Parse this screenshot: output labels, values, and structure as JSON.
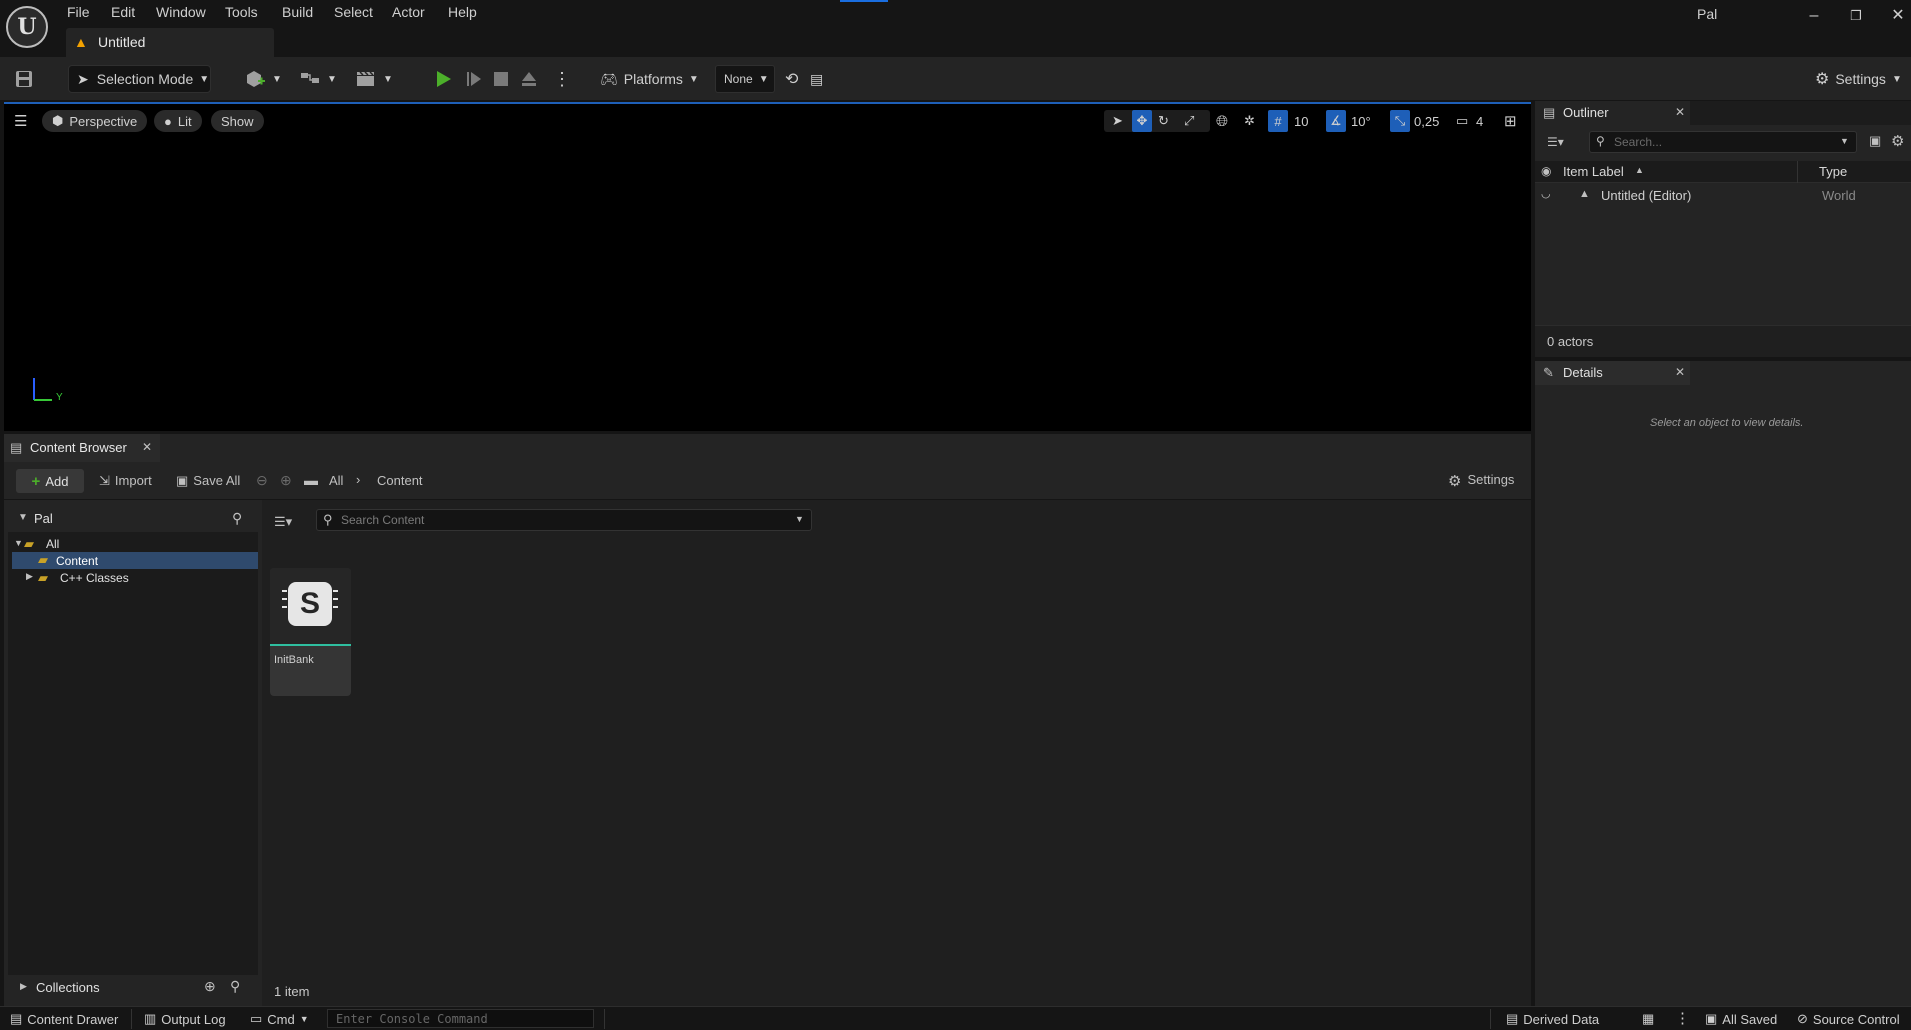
{
  "titlebar": {
    "menus": [
      "File",
      "Edit",
      "Window",
      "Tools",
      "Build",
      "Select",
      "Actor",
      "Help"
    ],
    "document_tab": "Untitled",
    "user": "Pal"
  },
  "toolbar": {
    "mode": "Selection Mode",
    "platforms": "Platforms",
    "none_select": "None",
    "settings": "Settings"
  },
  "viewport": {
    "perspective": "Perspective",
    "lit": "Lit",
    "show": "Show",
    "grid_snap": "10",
    "rotation_snap": "10°",
    "scale_snap": "0,25",
    "camera_speed": "4",
    "axis_label": "Y"
  },
  "outliner": {
    "tab": "Outliner",
    "search_placeholder": "Search...",
    "col_label": "Item Label",
    "col_type": "Type",
    "rows": [
      {
        "label": "Untitled (Editor)",
        "type": "World"
      }
    ],
    "actor_count": "0 actors"
  },
  "details": {
    "tab": "Details",
    "empty_text": "Select an object to view details."
  },
  "content_browser": {
    "tab": "Content Browser",
    "add": "Add",
    "import": "Import",
    "save_all": "Save All",
    "crumb_all": "All",
    "crumb_content": "Content",
    "settings": "Settings",
    "sources_root": "Pal",
    "tree": [
      "All",
      "Content",
      "C++ Classes"
    ],
    "search_placeholder": "Search Content",
    "asset": {
      "name": "InitBank",
      "glyph": "S"
    },
    "item_count": "1 item",
    "collections": "Collections"
  },
  "statusbar": {
    "content_drawer": "Content Drawer",
    "output_log": "Output Log",
    "cmd": "Cmd",
    "console_placeholder": "Enter Console Command",
    "derived_data": "Derived Data",
    "all_saved": "All Saved",
    "source_control": "Source Control"
  },
  "colors": {
    "accent": "#1e5fb8",
    "play_green": "#4caf2a",
    "warning_orange": "#f2a100"
  }
}
